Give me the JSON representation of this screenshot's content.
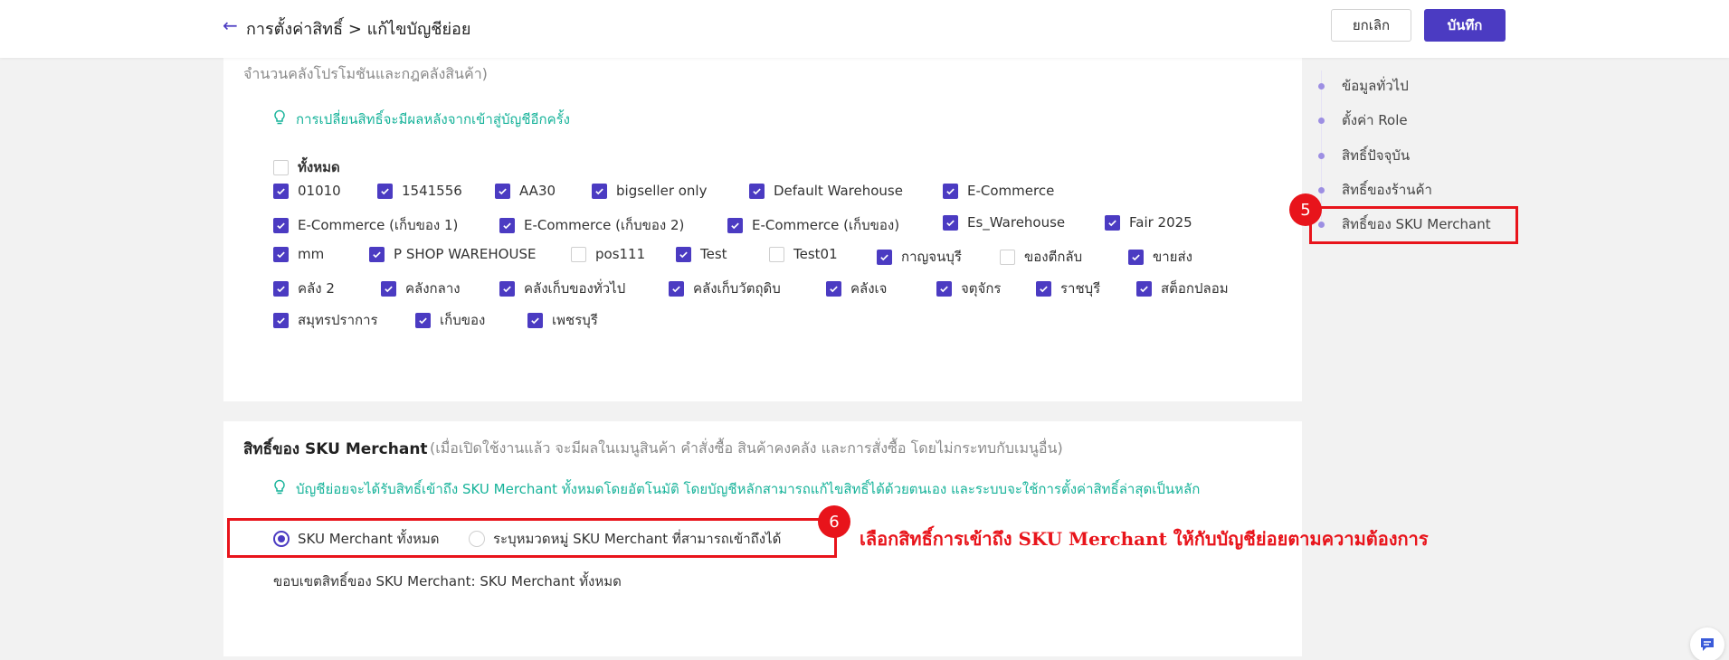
{
  "header": {
    "title": "การตั้งค่าสิทธิ์ > แก้ไขบัญชีย่อย",
    "cancel_label": "ยกเลิก",
    "save_label": "บันทึก"
  },
  "warehouse_section": {
    "desc_partial": "จำนวนคลังโปรโมชันและกฎคลังสินค้า)",
    "tip": "การเปลี่ยนสิทธิ์จะมีผลหลังจากเข้าสู่บัญชีอีกครั้ง",
    "select_all": {
      "label": "ทั้งหมด",
      "checked": false
    },
    "warehouses": [
      {
        "label": "01010",
        "checked": true
      },
      {
        "label": "1541556",
        "checked": true
      },
      {
        "label": "AA30",
        "checked": true
      },
      {
        "label": "bigseller only",
        "checked": true
      },
      {
        "label": "Default Warehouse",
        "checked": true
      },
      {
        "label": "E-Commerce",
        "checked": true
      },
      {
        "label": "E-Commerce (เก็บของ 1)",
        "checked": true
      },
      {
        "label": "E-Commerce (เก็บของ 2)",
        "checked": true
      },
      {
        "label": "E-Commerce (เก็บของ)",
        "checked": true
      },
      {
        "label": "Es_Warehouse",
        "checked": true
      },
      {
        "label": "Fair 2025",
        "checked": true
      },
      {
        "label": "mm",
        "checked": true
      },
      {
        "label": "P SHOP WAREHOUSE",
        "checked": true
      },
      {
        "label": "pos111",
        "checked": false
      },
      {
        "label": "Test",
        "checked": true
      },
      {
        "label": "Test01",
        "checked": false
      },
      {
        "label": "กาญจนบุรี",
        "checked": true
      },
      {
        "label": "ของตีกลับ",
        "checked": false
      },
      {
        "label": "ขายส่ง",
        "checked": true
      },
      {
        "label": "คลัง 2",
        "checked": true
      },
      {
        "label": "คลังกลาง",
        "checked": true
      },
      {
        "label": "คลังเก็บของทั่วไป",
        "checked": true
      },
      {
        "label": "คลังเก็บวัตถุดิบ",
        "checked": true
      },
      {
        "label": "คลังเจ",
        "checked": true
      },
      {
        "label": "จตุจักร",
        "checked": true
      },
      {
        "label": "ราชบุรี",
        "checked": true
      },
      {
        "label": "สต็อกปลอม",
        "checked": true
      },
      {
        "label": "สมุทรปราการ",
        "checked": true
      },
      {
        "label": "เก็บของ",
        "checked": true
      },
      {
        "label": "เพชรบุรี",
        "checked": true
      }
    ]
  },
  "sku_section": {
    "title": "สิทธิ์ของ SKU Merchant",
    "desc": "(เมื่อเปิดใช้งานแล้ว จะมีผลในเมนูสินค้า คำสั่งซื้อ สินค้าคงคลัง และการสั่งซื้อ โดยไม่กระทบกับเมนูอื่น)",
    "tip": "บัญชีย่อยจะได้รับสิทธิ์เข้าถึง SKU Merchant ทั้งหมดโดยอัตโนมัติ โดยบัญชีหลักสามารถแก้ไขสิทธิ์ได้ด้วยตนเอง และระบบจะใช้การตั้งค่าสิทธิ์ล่าสุดเป็นหลัก",
    "options": [
      {
        "label": "SKU Merchant ทั้งหมด",
        "selected": true
      },
      {
        "label": "ระบุหมวดหมู่ SKU Merchant ที่สามารถเข้าถึงได้",
        "selected": false
      }
    ],
    "scope": "ขอบเขตสิทธิ์ของ SKU Merchant: SKU Merchant ทั้งหมด"
  },
  "nav": {
    "items": [
      "ข้อมูลทั่วไป",
      "ตั้งค่า Role",
      "สิทธิ์ปัจจุบัน",
      "สิทธิ์ของร้านค้า",
      "สิทธิ์ของ SKU Merchant"
    ]
  },
  "annotations": {
    "badge5": "5",
    "badge6": "6",
    "note": "เลือกสิทธิ์การเข้าถึง SKU Merchant ให้กับบัญชีย่อยตามความต้องการ",
    "color": "#e8141b"
  },
  "colors": {
    "accent": "#4b3bc2",
    "tip": "#17b39a"
  }
}
